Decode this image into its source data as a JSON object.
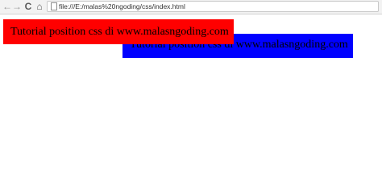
{
  "browser": {
    "back_glyph": "←",
    "forward_glyph": "→",
    "reload_glyph": "C",
    "home_glyph": "⌂",
    "url": "file:///E:/malas%20ngoding/css/index.html"
  },
  "page": {
    "red_box_text": "Tutorial position css di www.malasngoding.com",
    "blue_box_text": "Tutorial position css di www.malasngoding.com",
    "red_box_color": "#ff0000",
    "blue_box_color": "#0000ff"
  }
}
